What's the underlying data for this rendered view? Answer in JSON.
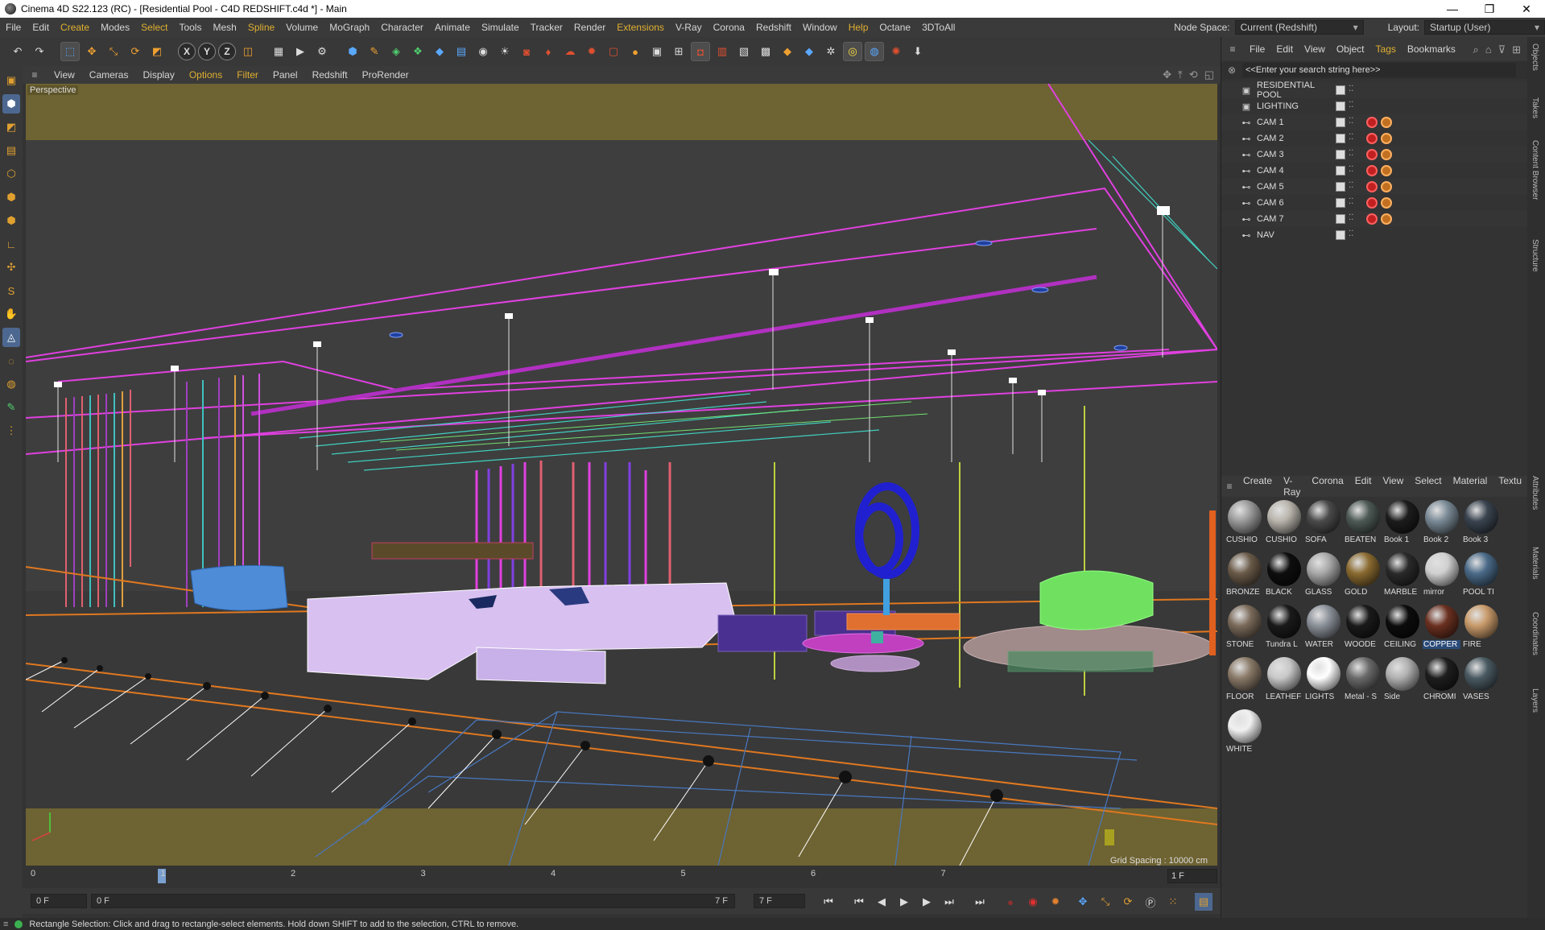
{
  "window": {
    "title": "Cinema 4D S22.123 (RC) - [Residential Pool - C4D REDSHIFT.c4d *] - Main",
    "controls": [
      "—",
      "❐",
      "✕"
    ]
  },
  "menubar": {
    "items": [
      "File",
      "Edit",
      "Create",
      "Modes",
      "Select",
      "Tools",
      "Mesh",
      "Spline",
      "Volume",
      "MoGraph",
      "Character",
      "Animate",
      "Simulate",
      "Tracker",
      "Render",
      "Extensions",
      "V-Ray",
      "Corona",
      "Redshift",
      "Window",
      "Help",
      "Octane",
      "3DToAll"
    ],
    "highlighted": [
      "Create",
      "Select",
      "Spline",
      "Extensions",
      "Help"
    ],
    "node_space_label": "Node Space:",
    "node_space_value": "Current (Redshift)",
    "layout_label": "Layout:",
    "layout_value": "Startup (User)"
  },
  "toolbar": {
    "icons": [
      "undo-icon",
      "redo-icon",
      "select-icon",
      "move-icon",
      "scale-icon",
      "rotate-icon",
      "transform-icon",
      "x-axis-icon",
      "y-axis-icon",
      "z-axis-icon",
      "world-coord-icon",
      "render-view-icon",
      "render-picture-icon",
      "render-settings-icon",
      "cube-icon",
      "pen-icon",
      "subdivision-icon",
      "cloner-icon",
      "deformer-icon",
      "floor-icon",
      "camera-icon",
      "light-icon",
      "redshift-camera-icon",
      "redshift-light-icon",
      "redshift-sky-icon",
      "redshift-sun-icon",
      "redshift-volume-icon",
      "material-icon",
      "ipr-icon",
      "render-icon",
      "proxy-icon",
      "texture-icon",
      "aov-icon",
      "settings-icon",
      "vray-icon",
      "vray-light-icon",
      "gear-icon",
      "corona-icon",
      "octane-icon",
      "octane-render-icon",
      "download-icon"
    ]
  },
  "viewport": {
    "menu": [
      "View",
      "Cameras",
      "Display",
      "Options",
      "Filter",
      "Panel",
      "Redshift",
      "ProRender"
    ],
    "highlighted": [
      "Options",
      "Filter"
    ],
    "label": "Perspective",
    "grid_spacing": "Grid Spacing : 10000 cm"
  },
  "timeline": {
    "ticks": [
      "0",
      "1",
      "2",
      "3",
      "4",
      "5",
      "6",
      "7"
    ],
    "current_frame": "1 F",
    "playhead_frame": 1
  },
  "transport": {
    "start_field": "0 F",
    "slider_start": "0 F",
    "slider_end": "7 F",
    "end_field": "7 F"
  },
  "status": {
    "text": "Rectangle Selection: Click and drag to rectangle-select elements. Hold down SHIFT to add to the selection, CTRL to remove."
  },
  "object_manager": {
    "menu": [
      "File",
      "Edit",
      "View",
      "Object",
      "Tags",
      "Bookmarks"
    ],
    "highlighted": [
      "Tags"
    ],
    "search_placeholder": "<<Enter your search string here>>",
    "objects": [
      {
        "name": "RESIDENTIAL POOL",
        "type": "layer",
        "tags": false
      },
      {
        "name": "LIGHTING",
        "type": "layer",
        "tags": false
      },
      {
        "name": "CAM 1",
        "type": "camera",
        "tags": true
      },
      {
        "name": "CAM 2",
        "type": "camera",
        "tags": true
      },
      {
        "name": "CAM 3",
        "type": "camera",
        "tags": true
      },
      {
        "name": "CAM 4",
        "type": "camera",
        "tags": true
      },
      {
        "name": "CAM 5",
        "type": "camera",
        "tags": true
      },
      {
        "name": "CAM 6",
        "type": "camera",
        "tags": true
      },
      {
        "name": "CAM 7",
        "type": "camera",
        "tags": true
      },
      {
        "name": "NAV",
        "type": "camera",
        "tags": false
      }
    ]
  },
  "side_tabs": {
    "top": [
      "Objects",
      "Takes",
      "Content Browser",
      "Structure"
    ],
    "bottom": [
      "Attributes",
      "Materials",
      "Coordinates",
      "Layers"
    ]
  },
  "material_manager": {
    "menu": [
      "Create",
      "V-Ray",
      "Corona",
      "Edit",
      "View",
      "Select",
      "Material",
      "Textu"
    ],
    "materials": [
      {
        "label": "CUSHIO",
        "color": "#9a9a9a",
        "selected": false
      },
      {
        "label": "CUSHIO",
        "color": "#b8b4ac",
        "selected": false
      },
      {
        "label": "SOFA",
        "color": "#4a4a4a",
        "selected": false
      },
      {
        "label": "BEATEN",
        "color": "#4e5a56",
        "selected": false
      },
      {
        "label": "Book 1",
        "color": "#1c1c1c",
        "selected": false
      },
      {
        "label": "Book 2",
        "color": "#7a8a96",
        "selected": false
      },
      {
        "label": "Book 3",
        "color": "#3a4450",
        "selected": false
      },
      {
        "label": "BRONZE",
        "color": "#6a5a48",
        "selected": false
      },
      {
        "label": "BLACK",
        "color": "#0e0e0e",
        "selected": false
      },
      {
        "label": "GLASS",
        "color": "#a8a8a8",
        "selected": false
      },
      {
        "label": "GOLD",
        "color": "#8a6a30",
        "selected": false
      },
      {
        "label": "MARBLE",
        "color": "#2a2a2a",
        "selected": false
      },
      {
        "label": "mirror",
        "color": "#d0d0d0",
        "selected": false
      },
      {
        "label": "POOL TI",
        "color": "#4a6a88",
        "selected": false
      },
      {
        "label": "STONE",
        "color": "#7a6a5a",
        "selected": false
      },
      {
        "label": "Tundra L",
        "color": "#1a1a1a",
        "selected": false
      },
      {
        "label": "WATER",
        "color": "#8a9098",
        "selected": false
      },
      {
        "label": "WOODE",
        "color": "#1a1a1a",
        "selected": false
      },
      {
        "label": "CEILING",
        "color": "#0c0c0c",
        "selected": false
      },
      {
        "label": "COPPER",
        "color": "#6a3020",
        "selected": true
      },
      {
        "label": "FIRE",
        "color": "#c89a6a",
        "selected": false
      },
      {
        "label": "FLOOR",
        "color": "#8a7a68",
        "selected": false
      },
      {
        "label": "LEATHEF",
        "color": "#c8c8c8",
        "selected": false
      },
      {
        "label": "LIGHTS",
        "color": "#ffffff",
        "selected": false
      },
      {
        "label": "Metal - S",
        "color": "#6a6a6a",
        "selected": false
      },
      {
        "label": "Side",
        "color": "#b0b0b0",
        "selected": false
      },
      {
        "label": "CHROMI",
        "color": "#1e1e1e",
        "selected": false
      },
      {
        "label": "VASES",
        "color": "#4a5a62",
        "selected": false
      },
      {
        "label": "WHITE",
        "color": "#f0f0f0",
        "selected": false
      }
    ]
  },
  "colors": {
    "accent": "#e0b030",
    "selection": "#4d6890",
    "wire_magenta": "#e040e0",
    "wire_cyan": "#40d0c0",
    "wire_orange": "#e07820",
    "ground_band": "#6e6332",
    "sofa": "#d8c0f0",
    "sculpture": "#2020d0",
    "chair": "#70e060"
  }
}
